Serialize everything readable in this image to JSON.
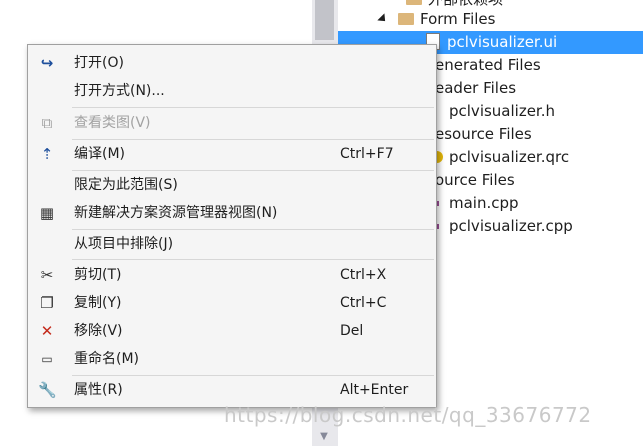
{
  "tree": {
    "rows": [
      {
        "label": "外部依赖项"
      },
      {
        "label": "Form Files"
      },
      {
        "label": "pclvisualizer.ui"
      },
      {
        "label": "enerated Files"
      },
      {
        "label": "eader Files"
      },
      {
        "label": "pclvisualizer.h"
      },
      {
        "label": "esource Files"
      },
      {
        "label": "pclvisualizer.qrc"
      },
      {
        "label": "ource Files"
      },
      {
        "label": "main.cpp"
      },
      {
        "label": "pclvisualizer.cpp"
      }
    ]
  },
  "menu": {
    "items": [
      {
        "label": "打开(O)",
        "shortcut": "",
        "icon": "open-arrow-icon"
      },
      {
        "label": "打开方式(N)...",
        "shortcut": "",
        "icon": ""
      },
      {
        "label": "查看类图(V)",
        "shortcut": "",
        "icon": "class-diagram-icon"
      },
      {
        "label": "编译(M)",
        "shortcut": "Ctrl+F7",
        "icon": "compile-icon"
      },
      {
        "label": "限定为此范围(S)",
        "shortcut": "",
        "icon": ""
      },
      {
        "label": "新建解决方案资源管理器视图(N)",
        "shortcut": "",
        "icon": "new-view-icon"
      },
      {
        "label": "从项目中排除(J)",
        "shortcut": "",
        "icon": ""
      },
      {
        "label": "剪切(T)",
        "shortcut": "Ctrl+X",
        "icon": "scissors-icon"
      },
      {
        "label": "复制(Y)",
        "shortcut": "Ctrl+C",
        "icon": "copy-icon"
      },
      {
        "label": "移除(V)",
        "shortcut": "Del",
        "icon": "remove-icon"
      },
      {
        "label": "重命名(M)",
        "shortcut": "",
        "icon": "rename-icon"
      },
      {
        "label": "属性(R)",
        "shortcut": "Alt+Enter",
        "icon": "wrench-icon"
      }
    ]
  },
  "watermark": "https://blog.csdn.net/qq_33676772",
  "colors": {
    "selection": "#3399ff",
    "remove": "#c42b1c",
    "open": "#1e4f9c"
  }
}
